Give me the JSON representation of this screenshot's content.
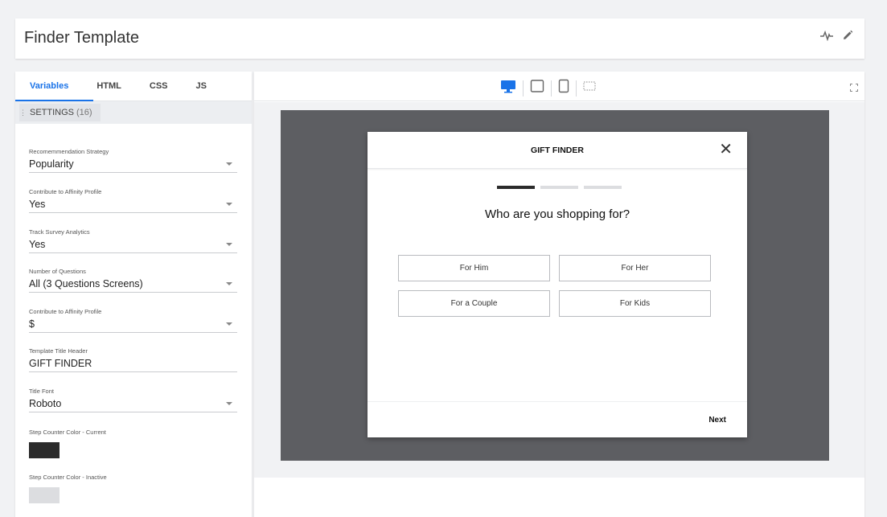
{
  "page": {
    "title": "Finder Template"
  },
  "header_icons": [
    "pulse-icon",
    "pencil-icon"
  ],
  "tabs": [
    {
      "label": "Variables",
      "active": true
    },
    {
      "label": "HTML",
      "active": false
    },
    {
      "label": "CSS",
      "active": false
    },
    {
      "label": "JS",
      "active": false
    }
  ],
  "settings": {
    "label": "SETTINGS",
    "count": "(16)"
  },
  "fields": [
    {
      "label": "Recomemmendation Strategy",
      "value": "Popularity",
      "type": "dropdown"
    },
    {
      "label": "Contribute to Affinity Profile",
      "value": "Yes",
      "type": "dropdown"
    },
    {
      "label": "Track Survey Analytics",
      "value": "Yes",
      "type": "dropdown"
    },
    {
      "label": "Number of Questions",
      "value": "All (3 Questions Screens)",
      "type": "dropdown"
    },
    {
      "label": "Contribute to Affinity Profile",
      "value": "$",
      "type": "dropdown"
    },
    {
      "label": "Template Title Header",
      "value": "GIFT FINDER",
      "type": "text"
    },
    {
      "label": "Title Font",
      "value": "Roboto",
      "type": "dropdown"
    }
  ],
  "color_fields": [
    {
      "label": "Step Counter Color - Current",
      "color": "#2b2b2b"
    },
    {
      "label": "Step Counter Color - Inactive",
      "color": "#dcdde0"
    }
  ],
  "device_icons": [
    "desktop-icon",
    "tablet-landscape-icon",
    "tablet-portrait-icon",
    "responsive-icon"
  ],
  "colors": {
    "accent": "#1a73e8",
    "stage": "#5d5e62"
  },
  "modal": {
    "title": "GIFT FINDER",
    "close": "✕",
    "question": "Who are you shopping for?",
    "steps_current": 1,
    "steps_total": 3,
    "choices": [
      "For Him",
      "For Her",
      "For a Couple",
      "For Kids"
    ],
    "next_label": "Next"
  }
}
